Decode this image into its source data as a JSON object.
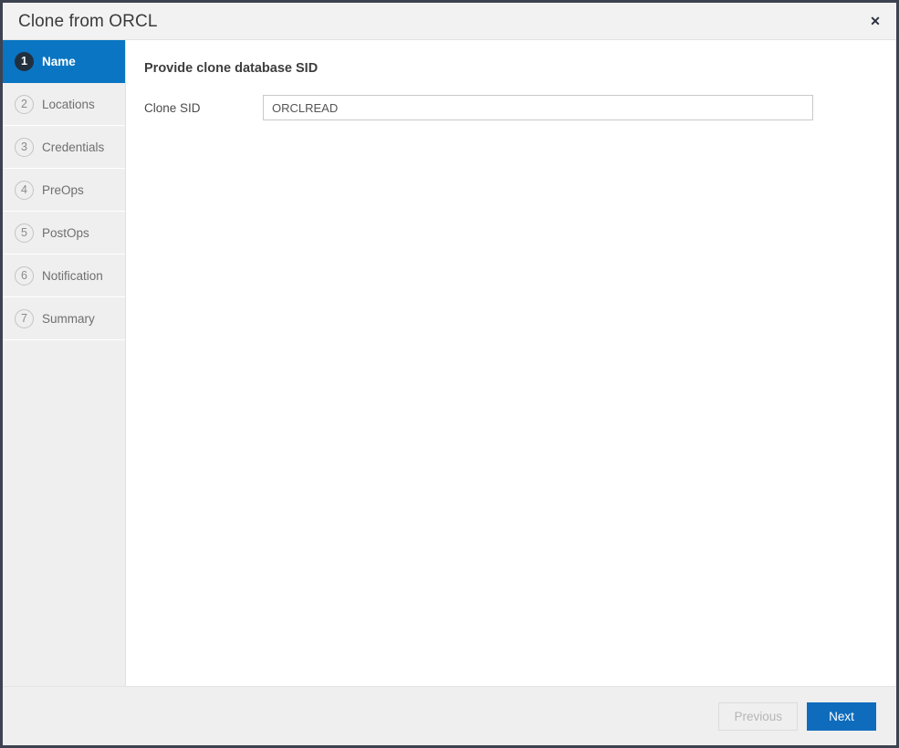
{
  "window": {
    "title": "Clone from ORCL",
    "close_icon": "close-icon",
    "close_glyph": "✕"
  },
  "sidebar": {
    "steps": [
      {
        "number": "1",
        "label": "Name",
        "active": true
      },
      {
        "number": "2",
        "label": "Locations",
        "active": false
      },
      {
        "number": "3",
        "label": "Credentials",
        "active": false
      },
      {
        "number": "4",
        "label": "PreOps",
        "active": false
      },
      {
        "number": "5",
        "label": "PostOps",
        "active": false
      },
      {
        "number": "6",
        "label": "Notification",
        "active": false
      },
      {
        "number": "7",
        "label": "Summary",
        "active": false
      }
    ]
  },
  "content": {
    "heading": "Provide clone database SID",
    "fields": [
      {
        "label": "Clone SID",
        "value": "ORCLREAD",
        "placeholder": ""
      }
    ]
  },
  "footer": {
    "previous_label": "Previous",
    "next_label": "Next"
  },
  "colors": {
    "accent_blue": "#0a75c2",
    "primary_button": "#0f6cbd",
    "frame_border": "#3c4250",
    "sidebar_bg": "#efefef",
    "active_badge": "#21303f"
  }
}
